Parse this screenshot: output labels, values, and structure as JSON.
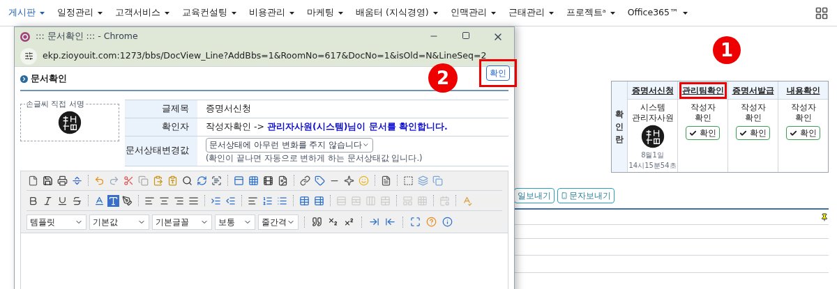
{
  "nav": {
    "items": [
      {
        "label": "게시판",
        "selected": true
      },
      {
        "label": "일정관리",
        "selected": false
      },
      {
        "label": "고객서비스",
        "selected": false
      },
      {
        "label": "교육컨설팅",
        "selected": false
      },
      {
        "label": "비용관리",
        "selected": false
      },
      {
        "label": "마케팅",
        "selected": false
      },
      {
        "label": "배움터 (지식경영)",
        "selected": false
      },
      {
        "label": "인맥관리",
        "selected": false
      },
      {
        "label": "근태관리",
        "selected": false
      },
      {
        "label": "프로젝트ᵃ",
        "selected": false
      },
      {
        "label": "Office365™",
        "selected": false
      }
    ]
  },
  "popup": {
    "title": "::: 문서확인 ::: - Chrome",
    "url": "ekp.zioyouit.com:1273/bbs/DocView_Line?AddBbs=1&RoomNo=617&DocNo=1&isOld=N&LineSeq=2",
    "heading": "문서확인",
    "step_badge": "2",
    "confirm_button": {
      "label": "확인",
      "highlighted": true
    },
    "signature_label": "손글씨 직접 서명",
    "fields": [
      {
        "kind": "text",
        "label": "글제목",
        "value": "증명서신청"
      },
      {
        "kind": "confirmer",
        "label": "확인자",
        "value": "작성자확인 ->",
        "emphasis": "관리자사원(시스템)님이 문서를 확인합니다."
      },
      {
        "kind": "select",
        "label": "문서상태변경값",
        "value": "문서상태에 아무런 변화를 주지 않습니다",
        "note": "(확인이 끝나면 자동으로 변하게 하는 문서상태값 입니다.)"
      }
    ],
    "editor": {
      "selects": [
        "템플릿",
        "기본값",
        "기본글꼴",
        "보통",
        "줄간격"
      ]
    }
  },
  "approval": {
    "step_badge": "1",
    "side_label": "확인란",
    "columns": [
      {
        "kind": "signed",
        "heading": "증명서신청",
        "highlighted": false,
        "lines": [
          "시스템",
          "관리자사원"
        ],
        "date": "8월1일",
        "time": "14시15분54초"
      },
      {
        "kind": "pending",
        "heading": "관리팀확인",
        "highlighted": true,
        "lines": [
          "작성자",
          "확인"
        ],
        "button": "확인"
      },
      {
        "kind": "pending",
        "heading": "증명서발급",
        "highlighted": false,
        "lines": [
          "작성자",
          "확인"
        ],
        "button": "확인"
      },
      {
        "kind": "pending",
        "heading": "내용확인",
        "highlighted": false,
        "lines": [
          "작성자",
          "확인"
        ],
        "button": "확인"
      }
    ]
  },
  "actions": [
    {
      "kind": "plain",
      "label": "일보내기"
    },
    {
      "kind": "phone",
      "label": "문자보내기"
    }
  ]
}
